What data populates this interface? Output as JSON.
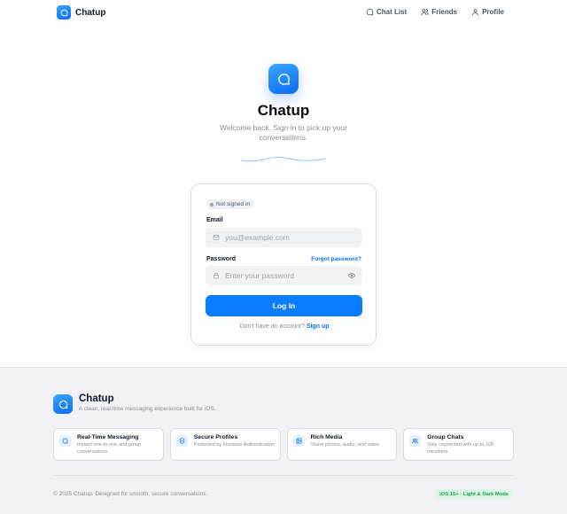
{
  "header": {
    "brand": "Chatup",
    "nav": [
      {
        "label": "Chat List",
        "icon": "chat-bubble-icon"
      },
      {
        "label": "Friends",
        "icon": "users-icon"
      },
      {
        "label": "Profile",
        "icon": "user-icon"
      }
    ]
  },
  "hero": {
    "title": "Chatup",
    "subtitle": "Welcome back. Sign in to pick up your conversations."
  },
  "login": {
    "status_badge": "Not signed in",
    "email_label": "Email",
    "email_placeholder": "you@example.com",
    "password_label": "Password",
    "forgot_label": "Forgot password?",
    "password_placeholder": "Enter your password",
    "submit_label": "Log In",
    "signup_prompt": "Don't have an account?",
    "signup_link": "Sign up"
  },
  "footer": {
    "brand": "Chatup",
    "tagline": "A clean, real-time messaging experience built for iOS.",
    "features": [
      {
        "title": "Real-Time Messaging",
        "desc": "Instant one-to-one and group conversations",
        "icon": "chat-bubble-icon"
      },
      {
        "title": "Secure Profiles",
        "desc": "Protected by Firebase Authentication",
        "icon": "shield-icon"
      },
      {
        "title": "Rich Media",
        "desc": "Share photos, audio, and video",
        "icon": "image-icon"
      },
      {
        "title": "Group Chats",
        "desc": "Stay connected with up to 100 members",
        "icon": "users-icon"
      }
    ],
    "copyright": "© 2025 Chatup. Designed for smooth, secure conversations.",
    "platform_badge": "iOS 15+ · Light & Dark Mode"
  },
  "colors": {
    "accent": "#0a7cff",
    "link": "#0a73f5",
    "footer_bg": "#f2f2f6",
    "badge_green": "#16a34a"
  }
}
